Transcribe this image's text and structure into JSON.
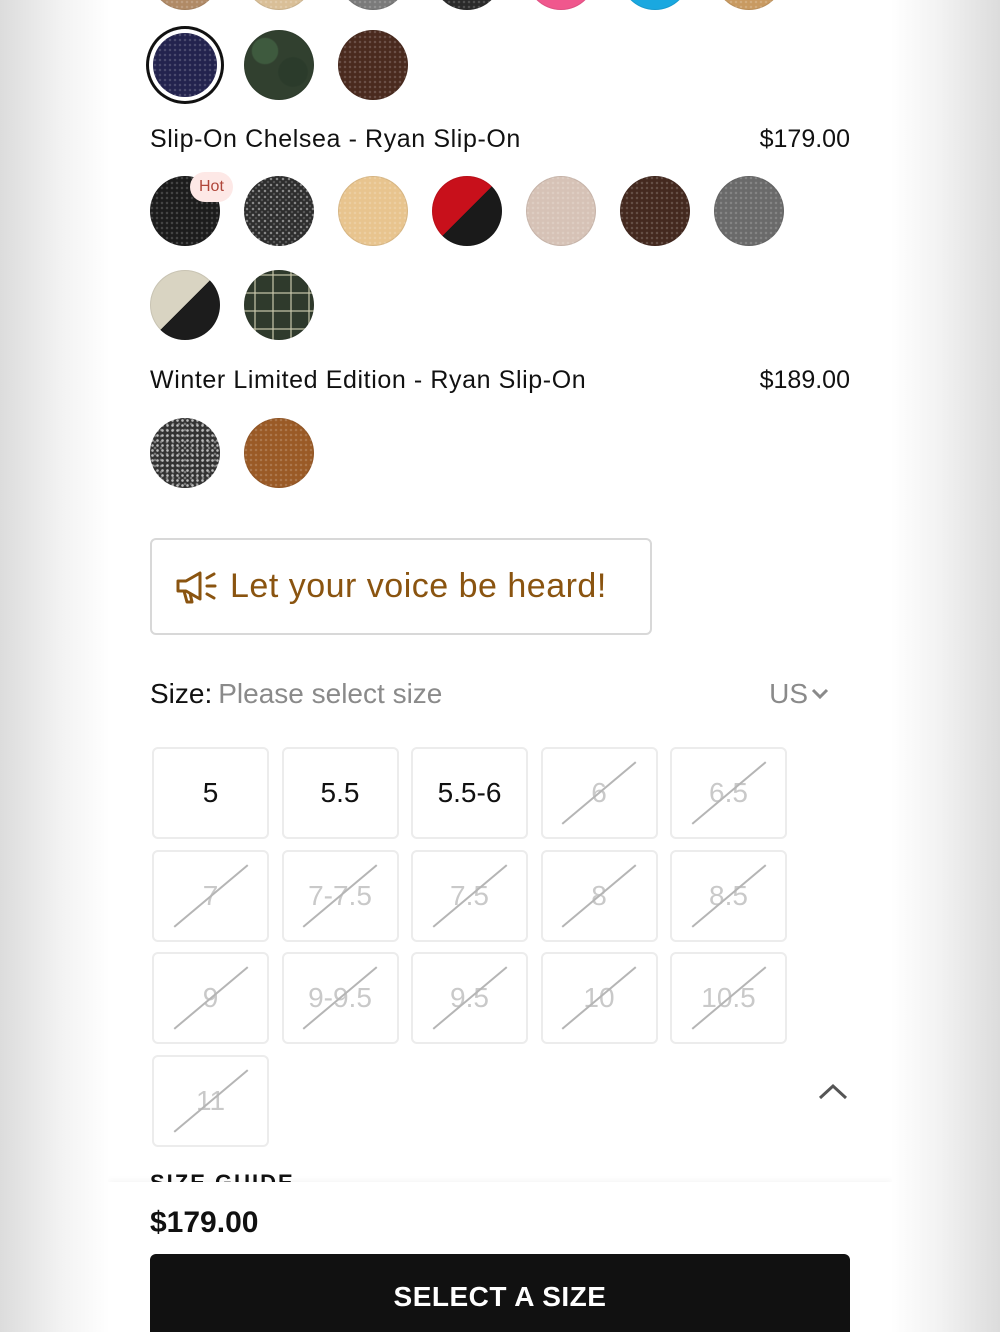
{
  "colors": {
    "accent_brown": "#8a5410",
    "hot_badge_bg": "#fde8e6",
    "hot_badge_text": "#b0463a",
    "button_bg": "#111111"
  },
  "slip_on_chelsea": {
    "title": "Slip-On Chelsea - Ryan Slip-On",
    "price": "$179.00",
    "hot_badge": "Hot"
  },
  "winter_limited": {
    "title": "Winter Limited Edition - Ryan Slip-On",
    "price": "$189.00"
  },
  "feedback": {
    "label": "Let your voice be heard!",
    "icon": "megaphone-icon"
  },
  "size": {
    "label": "Size:",
    "placeholder": "Please select size",
    "unit": "US",
    "options": [
      {
        "label": "5",
        "available": true
      },
      {
        "label": "5.5",
        "available": true
      },
      {
        "label": "5.5-6",
        "available": true
      },
      {
        "label": "6",
        "available": false
      },
      {
        "label": "6.5",
        "available": false
      },
      {
        "label": "7",
        "available": false
      },
      {
        "label": "7-7.5",
        "available": false
      },
      {
        "label": "7.5",
        "available": false
      },
      {
        "label": "8",
        "available": false
      },
      {
        "label": "8.5",
        "available": false
      },
      {
        "label": "9",
        "available": false
      },
      {
        "label": "9-9.5",
        "available": false
      },
      {
        "label": "9.5",
        "available": false
      },
      {
        "label": "10",
        "available": false
      },
      {
        "label": "10.5",
        "available": false
      },
      {
        "label": "11",
        "available": false
      }
    ],
    "guide_label": "SIZE GUIDE"
  },
  "footer": {
    "price": "$179.00",
    "button_label": "SELECT A SIZE"
  }
}
